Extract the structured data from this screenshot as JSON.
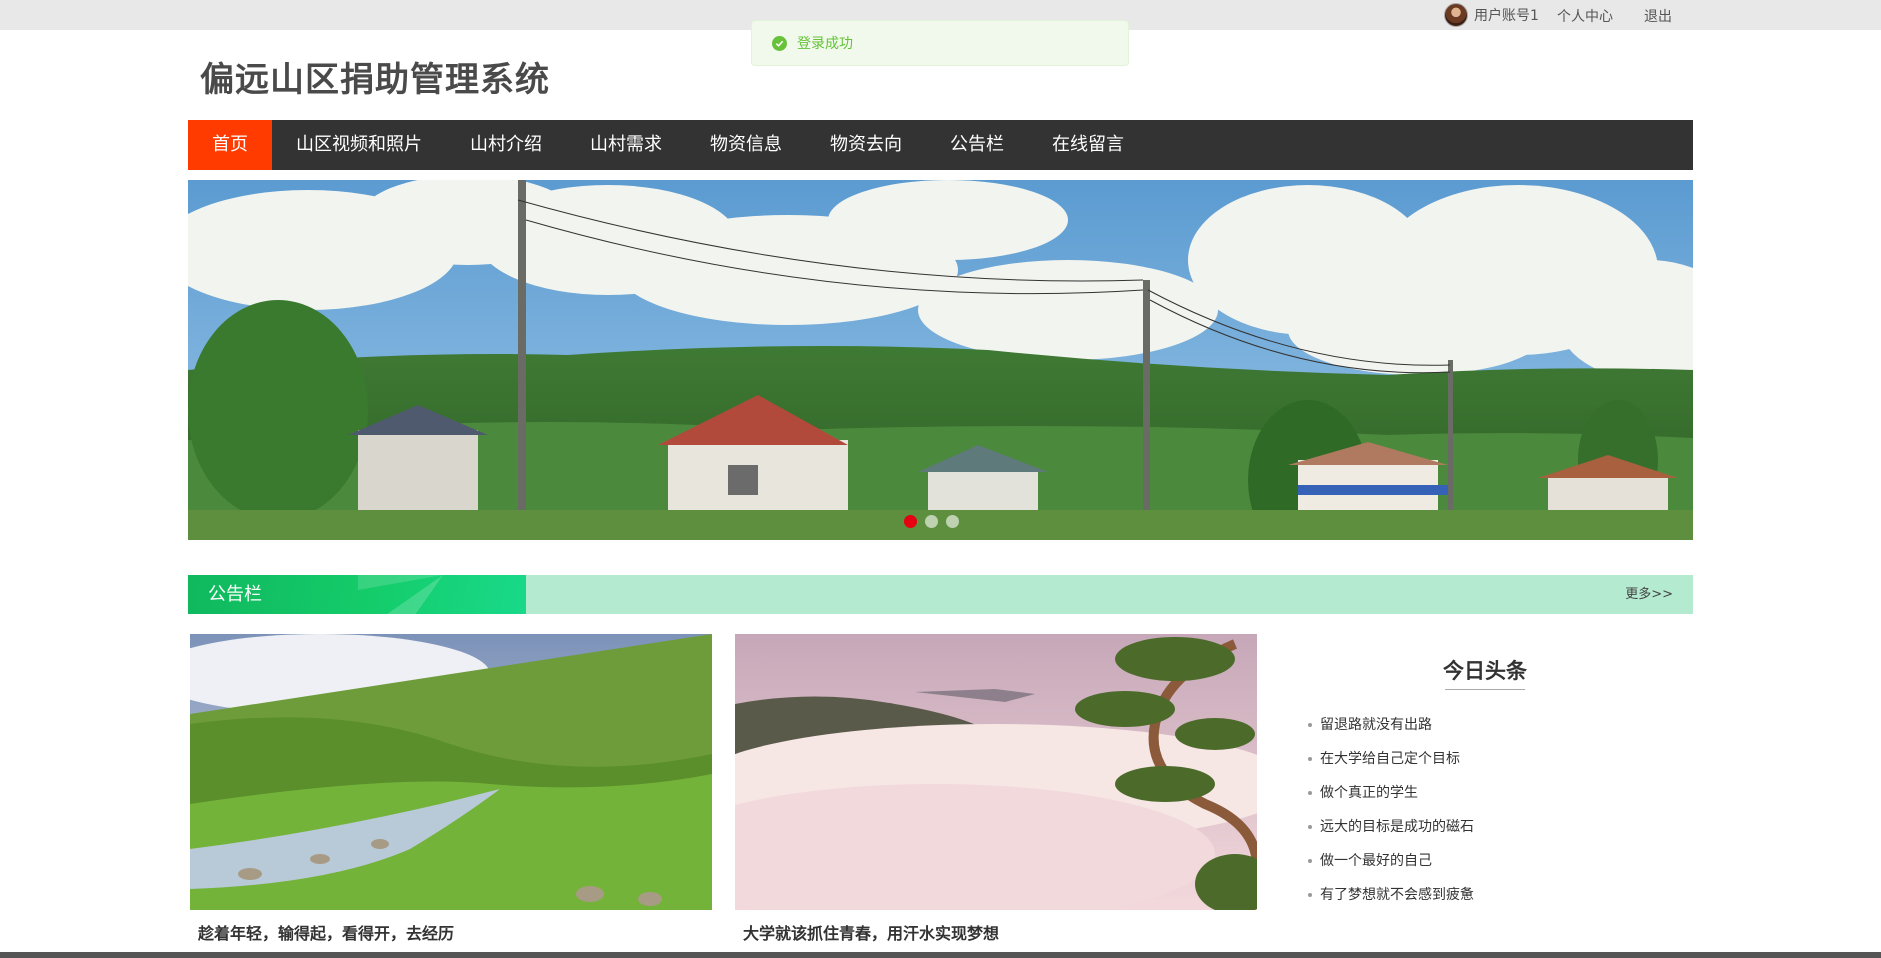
{
  "topbar": {
    "username": "用户账号1",
    "profile_link": "个人中心",
    "logout_link": "退出"
  },
  "toast": {
    "message": "登录成功"
  },
  "site": {
    "title": "偏远山区捐助管理系统"
  },
  "nav": {
    "items": [
      {
        "label": "首页",
        "active": true
      },
      {
        "label": "山区视频和照片"
      },
      {
        "label": "山村介绍"
      },
      {
        "label": "山村需求"
      },
      {
        "label": "物资信息"
      },
      {
        "label": "物资去向"
      },
      {
        "label": "公告栏"
      },
      {
        "label": "在线留言"
      }
    ]
  },
  "notice": {
    "title": "公告栏",
    "more": "更多>>"
  },
  "cards": [
    {
      "caption": "趁着年轻，输得起，看得开，去经历"
    },
    {
      "caption": "大学就该抓住青春，用汗水实现梦想"
    }
  ],
  "headlines": {
    "title": "今日头条",
    "items": [
      "留退路就没有出路",
      "在大学给自己定个目标",
      "做个真正的学生",
      "远大的目标是成功的磁石",
      "做一个最好的自己",
      "有了梦想就不会感到疲惫"
    ]
  },
  "colors": {
    "nav_bg": "#333333",
    "nav_active": "#ff3b00",
    "notice_head": "#10b85e",
    "notice_bar": "#b3ead0",
    "toast_text": "#67c23a",
    "carousel_active_dot": "#e60012"
  },
  "icons": [
    "avatar",
    "check-circle-icon"
  ]
}
